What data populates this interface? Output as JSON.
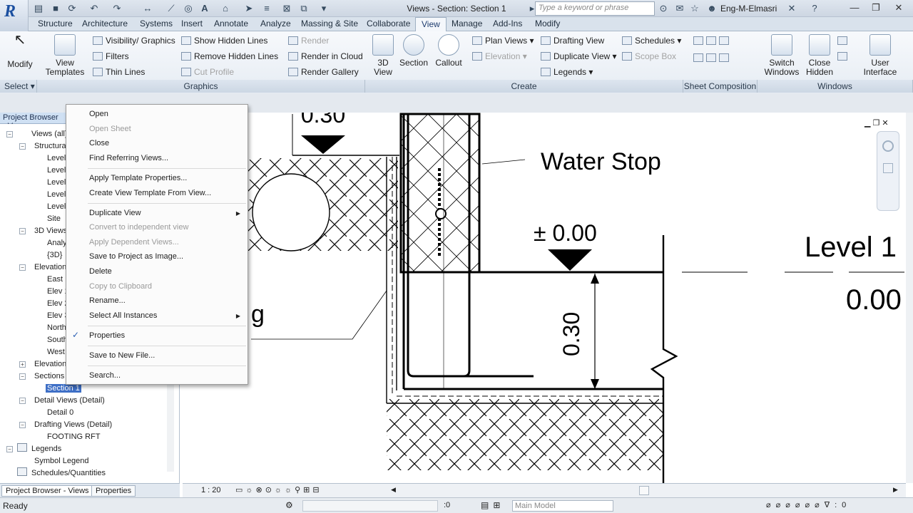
{
  "app": {
    "logo": "R"
  },
  "title": {
    "text": "Views - Section: Section 1"
  },
  "search": {
    "placeholder": "Type a keyword or phrase"
  },
  "user": {
    "name": "Eng-M-Elmasri"
  },
  "tabs": [
    "Structure",
    "Architecture",
    "Systems",
    "Insert",
    "Annotate",
    "Analyze",
    "Massing & Site",
    "Collaborate",
    "View",
    "Manage",
    "Add-Ins",
    "Modify"
  ],
  "active_tab": "View",
  "ribbon": {
    "modify": "Modify",
    "view_templates": "View Templates",
    "visibility": "Visibility/ Graphics",
    "filters": "Filters",
    "thin_lines": "Thin Lines",
    "show_hidden": "Show Hidden Lines",
    "remove_hidden": "Remove Hidden Lines",
    "cut_profile": "Cut Profile",
    "render": "Render",
    "render_cloud": "Render in Cloud",
    "render_gallery": "Render Gallery",
    "view3d": "3D View",
    "section": "Section",
    "callout": "Callout",
    "plan_views": "Plan Views",
    "elevation": "Elevation",
    "drafting_view": "Drafting View",
    "duplicate_view": "Duplicate View",
    "legends": "Legends",
    "schedules": "Schedules",
    "scope_box": "Scope Box",
    "switch_windows": "Switch Windows",
    "close_hidden": "Close Hidden",
    "user_interface": "User Interface",
    "panels": {
      "select": "Select",
      "graphics": "Graphics",
      "create": "Create",
      "sheet": "Sheet Composition",
      "windows": "Windows"
    }
  },
  "browser": {
    "header": "Project Browser - V",
    "items": {
      "views_all": "Views (all)",
      "structural": "Structura",
      "lv1": "Level",
      "lv2": "Level",
      "lv3": "Level",
      "lv4": "Level",
      "lv5": "Level",
      "site": "Site",
      "views3d": "3D Views",
      "analy": "Analy",
      "v3d": "{3D}",
      "elevations": "Elevation",
      "east": "East",
      "elev1": "Elev 1",
      "elev2": "Elev 2",
      "elev3": "Elev 3",
      "north": "North",
      "south": "South",
      "west": "West",
      "elevation2": "Elevation",
      "sections": "Sections",
      "section1": "Section 1",
      "detail_views": "Detail Views (Detail)",
      "detail0": "Detail 0",
      "drafting": "Drafting Views (Detail)",
      "footing": "FOOTING RFT",
      "legends": "Legends",
      "symbol_legend": "Symbol Legend",
      "schedules": "Schedules/Quantities"
    },
    "tab_views": "Project Browser - Views",
    "tab_props": "Properties"
  },
  "context_menu": {
    "open": "Open",
    "open_sheet": "Open Sheet",
    "close": "Close",
    "find_ref": "Find Referring Views...",
    "apply_tpl": "Apply Template Properties...",
    "create_tpl": "Create View Template From View...",
    "duplicate": "Duplicate View",
    "convert": "Convert to independent view",
    "apply_dep": "Apply Dependent Views...",
    "save_image": "Save to Project as Image...",
    "delete": "Delete",
    "copy": "Copy to Clipboard",
    "rename": "Rename...",
    "select_all": "Select All Instances",
    "properties": "Properties",
    "save_new": "Save to New File...",
    "search": "Search..."
  },
  "drawing": {
    "water_stop": "Water Stop",
    "elev_000": "± 0.00",
    "level1": "Level 1",
    "level_val": "0.00",
    "dim_030": "0.30",
    "top_030": "0.30",
    "g_text": "g"
  },
  "view_control": {
    "scale": "1 : 20"
  },
  "status": {
    "text": "Ready",
    "zero": ":0",
    "model": "Main Model"
  }
}
